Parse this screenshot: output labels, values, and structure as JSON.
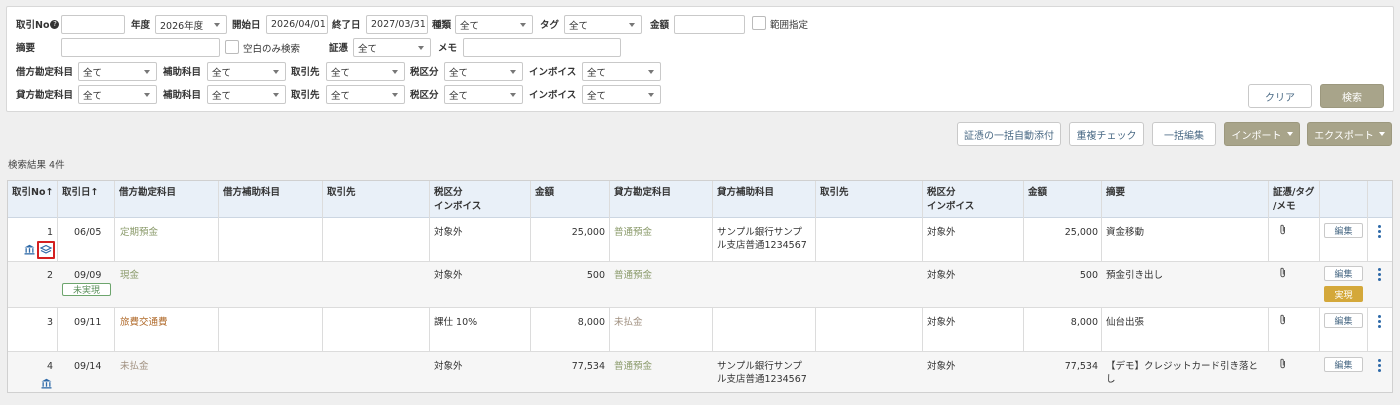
{
  "filters": {
    "torihiki_no_label": "取引No",
    "torihiki_no_help": "?",
    "nendo_label": "年度",
    "nendo_value": "2026年度",
    "start_label": "開始日",
    "start_value": "2026/04/01",
    "end_label": "終了日",
    "end_value": "2027/03/31",
    "shurui_label": "種類",
    "shurui_value": "全て",
    "tag_label": "タグ",
    "tag_value": "全て",
    "kingaku_label": "金額",
    "range_label": "範囲指定",
    "tekiyo_label": "摘要",
    "blank_only_label": "空白のみ検索",
    "shohyo_label": "証憑",
    "shohyo_value": "全て",
    "memo_label": "メモ",
    "debit_row": {
      "account_label": "借方勘定科目",
      "account_value": "全て",
      "sub_label": "補助科目",
      "sub_value": "全て",
      "partner_label": "取引先",
      "partner_value": "全て",
      "tax_label": "税区分",
      "tax_value": "全て",
      "invoice_label": "インボイス",
      "invoice_value": "全て"
    },
    "credit_row": {
      "account_label": "貸方勘定科目",
      "account_value": "全て",
      "sub_label": "補助科目",
      "sub_value": "全て",
      "partner_label": "取引先",
      "partner_value": "全て",
      "tax_label": "税区分",
      "tax_value": "全て",
      "invoice_label": "インボイス",
      "invoice_value": "全て"
    },
    "clear_button": "クリア",
    "search_button": "検索"
  },
  "toolbar": {
    "auto_attach": "証憑の一括自動添付",
    "dup_check": "重複チェック",
    "bulk_edit": "一括編集",
    "import": "インポート",
    "export": "エクスポート"
  },
  "result_count": "検索結果 4件",
  "table": {
    "headers": {
      "no": "取引No↑",
      "date": "取引日↑",
      "debit_account": "借方勘定科目",
      "debit_sub": "借方補助科目",
      "debit_partner": "取引先",
      "debit_tax_1": "税区分",
      "debit_tax_2": "インボイス",
      "debit_amount": "金額",
      "credit_account": "貸方勘定科目",
      "credit_sub": "貸方補助科目",
      "credit_partner": "取引先",
      "credit_tax_1": "税区分",
      "credit_tax_2": "インボイス",
      "credit_amount": "金額",
      "summary": "摘要",
      "doc_1": "証憑/タグ",
      "doc_2": "/メモ"
    },
    "rows": [
      {
        "no": "1",
        "date": "06/05",
        "debit_account": "定期預金",
        "debit_tax": "対象外",
        "debit_amount": "25,000",
        "credit_account": "普通預金",
        "credit_sub_1": "サンプル銀行サンプ",
        "credit_sub_2": "ル支店普通1234567",
        "credit_tax": "対象外",
        "credit_amount": "25,000",
        "summary_1": "資金移動",
        "summary_2": "",
        "edit": "編集"
      },
      {
        "no": "2",
        "date": "09/09",
        "badge": "未実現",
        "debit_account": "現金",
        "debit_tax": "対象外",
        "debit_amount": "500",
        "credit_account": "普通預金",
        "credit_tax": "対象外",
        "credit_amount": "500",
        "summary_1": "預金引き出し",
        "summary_2": "",
        "edit": "編集",
        "jitsu": "実現"
      },
      {
        "no": "3",
        "date": "09/11",
        "debit_account": "旅費交通費",
        "debit_tax": "課仕 10%",
        "debit_amount": "8,000",
        "credit_account": "未払金",
        "credit_tax": "対象外",
        "credit_amount": "8,000",
        "summary_1": "仙台出張",
        "summary_2": "",
        "edit": "編集"
      },
      {
        "no": "4",
        "date": "09/14",
        "debit_account": "未払金",
        "debit_tax": "対象外",
        "debit_amount": "77,534",
        "credit_account": "普通預金",
        "credit_sub_1": "サンプル銀行サンプ",
        "credit_sub_2": "ル支店普通1234567",
        "credit_tax": "対象外",
        "credit_amount": "77,534",
        "summary_1": "【デモ】クレジットカード引き落と",
        "summary_2": "し",
        "edit": "編集"
      }
    ]
  },
  "icons": {
    "help": "question-circle-icon",
    "bank": "bank-icon",
    "journal": "layers-icon",
    "attach": "paperclip-icon",
    "menu": "vertical-ellipsis-icon"
  }
}
